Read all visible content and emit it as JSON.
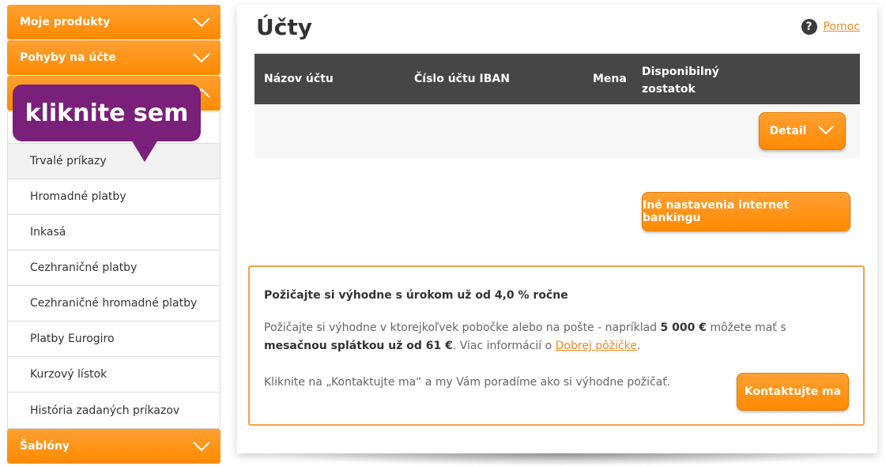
{
  "sidebar": {
    "sections": [
      {
        "label": "Moje produkty"
      },
      {
        "label": "Pohyby na účte"
      },
      {
        "label": ""
      }
    ],
    "items": [
      {
        "label": ""
      },
      {
        "label": "Trvalé príkazy"
      },
      {
        "label": "Hromadné platby"
      },
      {
        "label": "Inkasá"
      },
      {
        "label": "Cezhraničné platby"
      },
      {
        "label": "Cezhraničné hromadné platby"
      },
      {
        "label": "Platby Eurogiro"
      },
      {
        "label": "Kurzový lístok"
      },
      {
        "label": "História zadaných príkazov"
      }
    ],
    "bottom_section": {
      "label": "Šablóny"
    }
  },
  "tooltip": {
    "text": "kliknite sem"
  },
  "main": {
    "title": "Účty",
    "help": {
      "icon": "question-icon",
      "label": "Pomoc"
    },
    "table": {
      "columns": [
        "Názov účtu",
        "Číslo účtu IBAN",
        "Mena",
        "Disponibilný zostatok"
      ],
      "detail_button": "Detail"
    },
    "other_settings_button": "Iné nastavenia internet bankingu",
    "promo": {
      "title": "Požičajte si výhodne s úrokom už od 4,0 % ročne",
      "text_1": "Požičajte si výhodne v ktorejkoľvek pobočke alebo na pošte - napríklad ",
      "amount": "5 000 €",
      "text_2": " môžete mať s ",
      "bold_2": "mesačnou splátkou už od 61 €",
      "text_3": ". Viac informácií o ",
      "link": "Dobrej pôžičke",
      "text_4": ".",
      "note": "Kliknite na „Kontaktujte ma“ a my Vám poradíme ako si výhodne požičať.",
      "contact_button": "Kontaktujte ma"
    }
  },
  "colors": {
    "accent": "#ff8a00",
    "header_dark": "#464646",
    "tooltip": "#7a1f7a"
  }
}
